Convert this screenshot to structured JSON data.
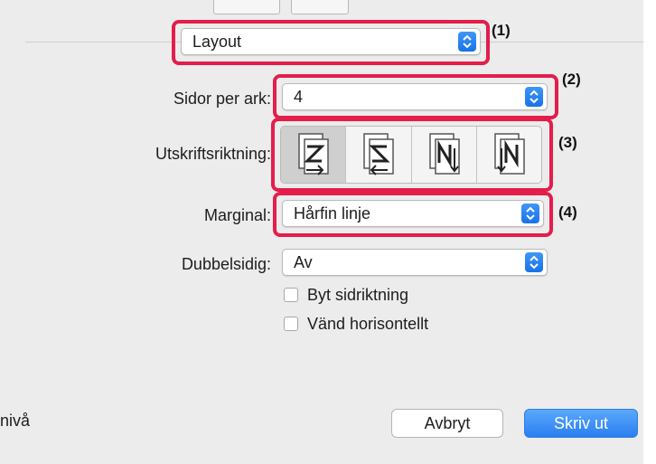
{
  "header": {
    "layout_popup_value": "Layout"
  },
  "fields": {
    "pages_per_sheet": {
      "label": "Sidor per ark:",
      "value": "4"
    },
    "print_direction": {
      "label": "Utskriftsriktning:",
      "options": [
        "Z-order",
        "reverse-Z-order",
        "N-order",
        "reverse-N-order"
      ],
      "selected_index": 0
    },
    "margin": {
      "label": "Marginal:",
      "value": "Hårfin linje"
    },
    "duplex": {
      "label": "Dubbelsidig:",
      "value": "Av"
    }
  },
  "checkboxes": [
    {
      "label": "Byt sidriktning",
      "checked": false
    },
    {
      "label": "Vänd horisontellt",
      "checked": false
    }
  ],
  "callouts": [
    "(1)",
    "(2)",
    "(3)",
    "(4)"
  ],
  "footer": {
    "partial_text": "nivå",
    "cancel_label": "Avbryt",
    "print_label": "Skriv ut"
  },
  "colors": {
    "highlight": "#e41d4a",
    "accent": "#1873e8"
  }
}
